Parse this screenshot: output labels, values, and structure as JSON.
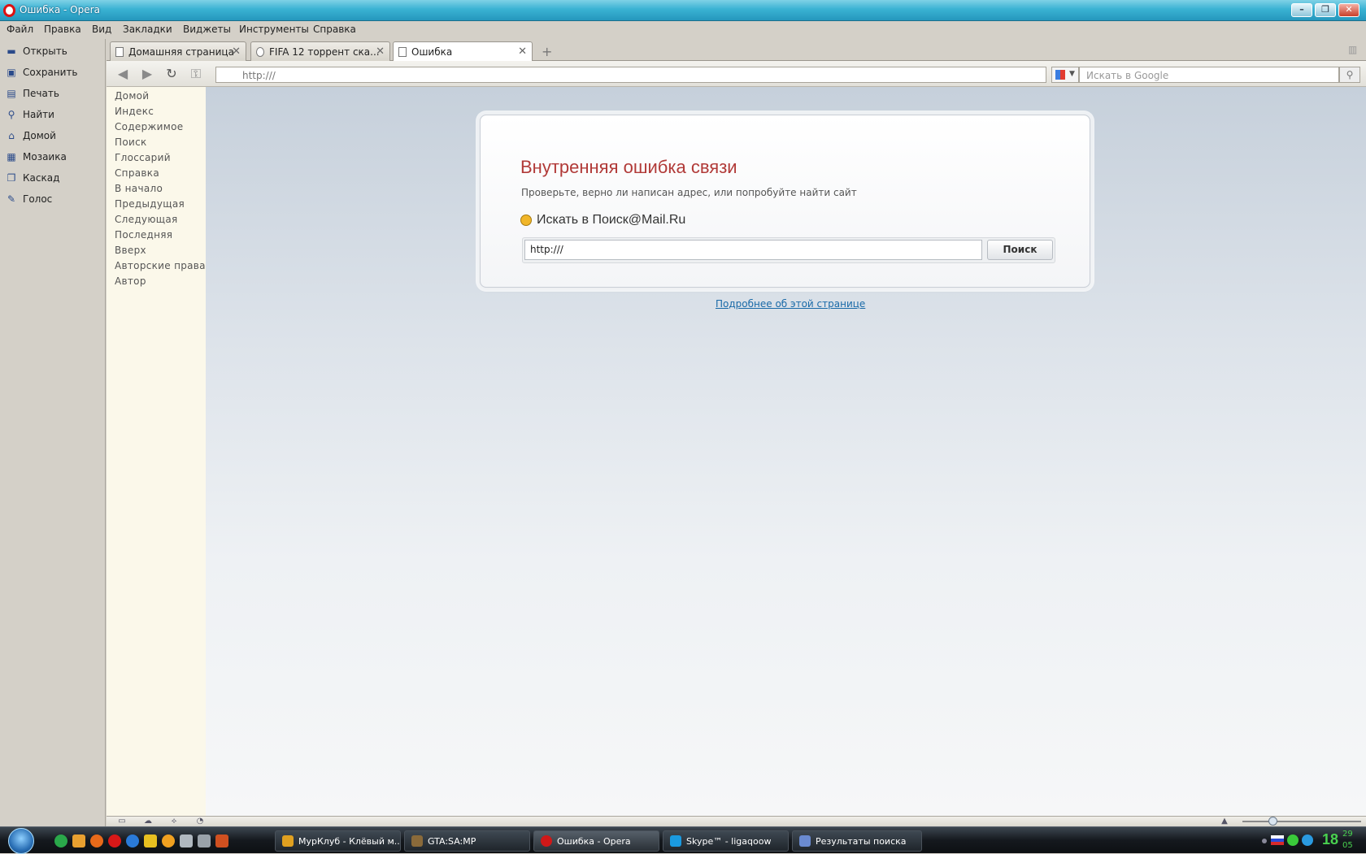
{
  "window": {
    "title": "Ошибка - Opera"
  },
  "menu": [
    "Файл",
    "Правка",
    "Вид",
    "Закладки",
    "Виджеты",
    "Инструменты",
    "Справка"
  ],
  "left_panel": [
    "Открыть",
    "Сохранить",
    "Печать",
    "Найти",
    "Домой",
    "Мозаика",
    "Каскад",
    "Голос"
  ],
  "tabs": [
    {
      "label": "Домашняя страница"
    },
    {
      "label": "FIFA 12 торрент ска..."
    },
    {
      "label": "Ошибка"
    }
  ],
  "address": {
    "value": "http:///"
  },
  "google_search": {
    "placeholder": "Искать в Google"
  },
  "help_nav": [
    "Домой",
    "Индекс",
    "Содержимое",
    "Поиск",
    "Глоссарий",
    "Справка",
    "В начало",
    "Предыдущая",
    "Следующая",
    "Последняя",
    "Вверх",
    "Авторские права",
    "Автор"
  ],
  "error": {
    "title": "Внутренняя ошибка связи",
    "description": "Проверьте, верно ли написан адрес, или попробуйте найти сайт",
    "search_heading": "Искать в Поиск@Mail.Ru",
    "search_value": "http:///",
    "search_button": "Поиск",
    "more_link": "Подробнее об этой странице"
  },
  "taskbar": {
    "buttons": [
      {
        "label": "МурКлуб - Клёвый м...",
        "color": "#e0a020"
      },
      {
        "label": "GTA:SA:MP",
        "color": "#8a6a3a"
      },
      {
        "label": "Ошибка - Opera",
        "color": "#d01818"
      },
      {
        "label": "Skype™ - ligaqoow",
        "color": "#1a9ae0"
      },
      {
        "label": "Результаты поиска",
        "color": "#6a8ad0"
      }
    ],
    "clock": {
      "hour": "18",
      "minute": "29",
      "sub": "05"
    }
  },
  "colors": {
    "error_title": "#b13a38",
    "link": "#1a6aa8",
    "opera_red": "#c92a2a",
    "clock": "#49d14f"
  }
}
